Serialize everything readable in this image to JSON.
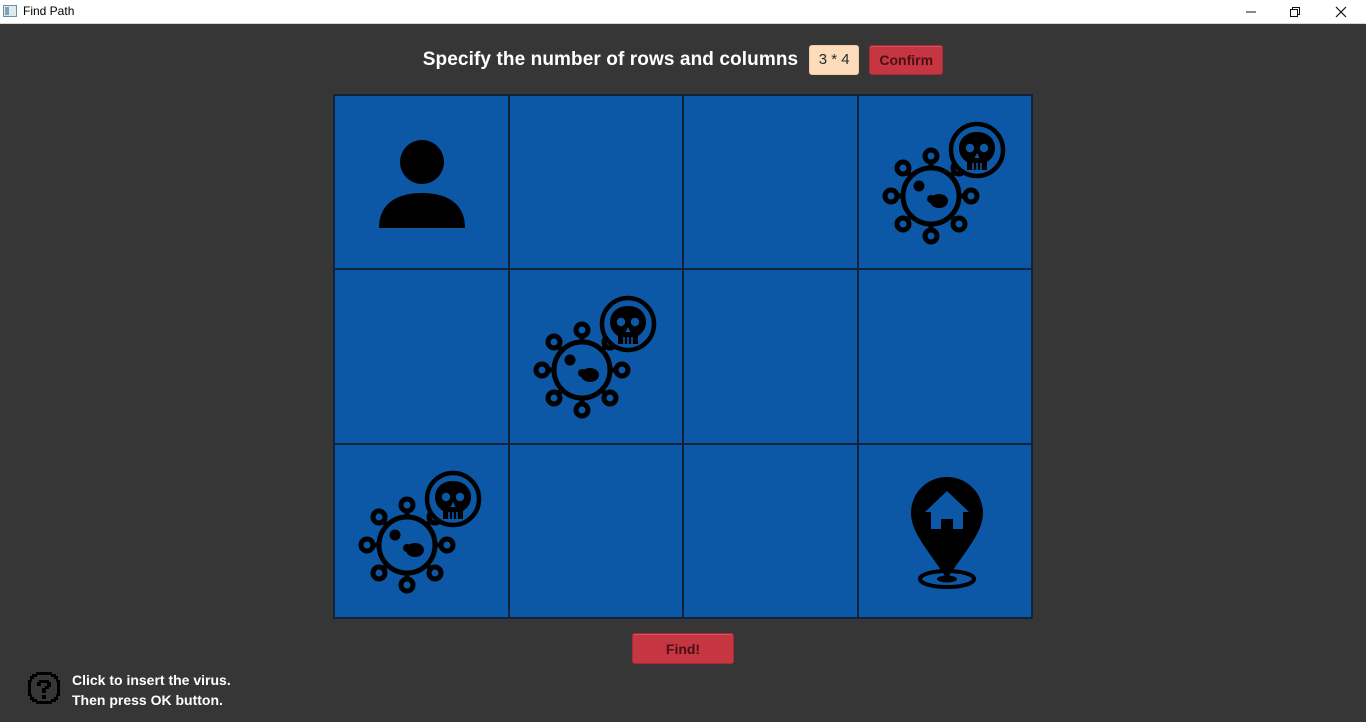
{
  "window": {
    "title": "Find Path",
    "minimize_icon": "minimize-icon",
    "maximize_icon": "restore-icon",
    "close_icon": "close-icon"
  },
  "header": {
    "prompt": "Specify the number of rows and columns",
    "dims_value": "3 * 4",
    "confirm_label": "Confirm"
  },
  "grid": {
    "rows": 3,
    "columns": 4,
    "cell_color": "#0c58a6",
    "line_color": "#10233a",
    "cells": [
      [
        "person",
        "empty",
        "empty",
        "virus"
      ],
      [
        "empty",
        "virus",
        "empty",
        "empty"
      ],
      [
        "virus",
        "empty",
        "empty",
        "home"
      ]
    ]
  },
  "actions": {
    "find_label": "Find!"
  },
  "hint": {
    "icon": "question-icon",
    "line1": "Click to insert the virus.",
    "line2": "Then press OK button."
  },
  "colors": {
    "background": "#363636",
    "button_red": "#c63542",
    "input_bg": "#fddcbc"
  }
}
